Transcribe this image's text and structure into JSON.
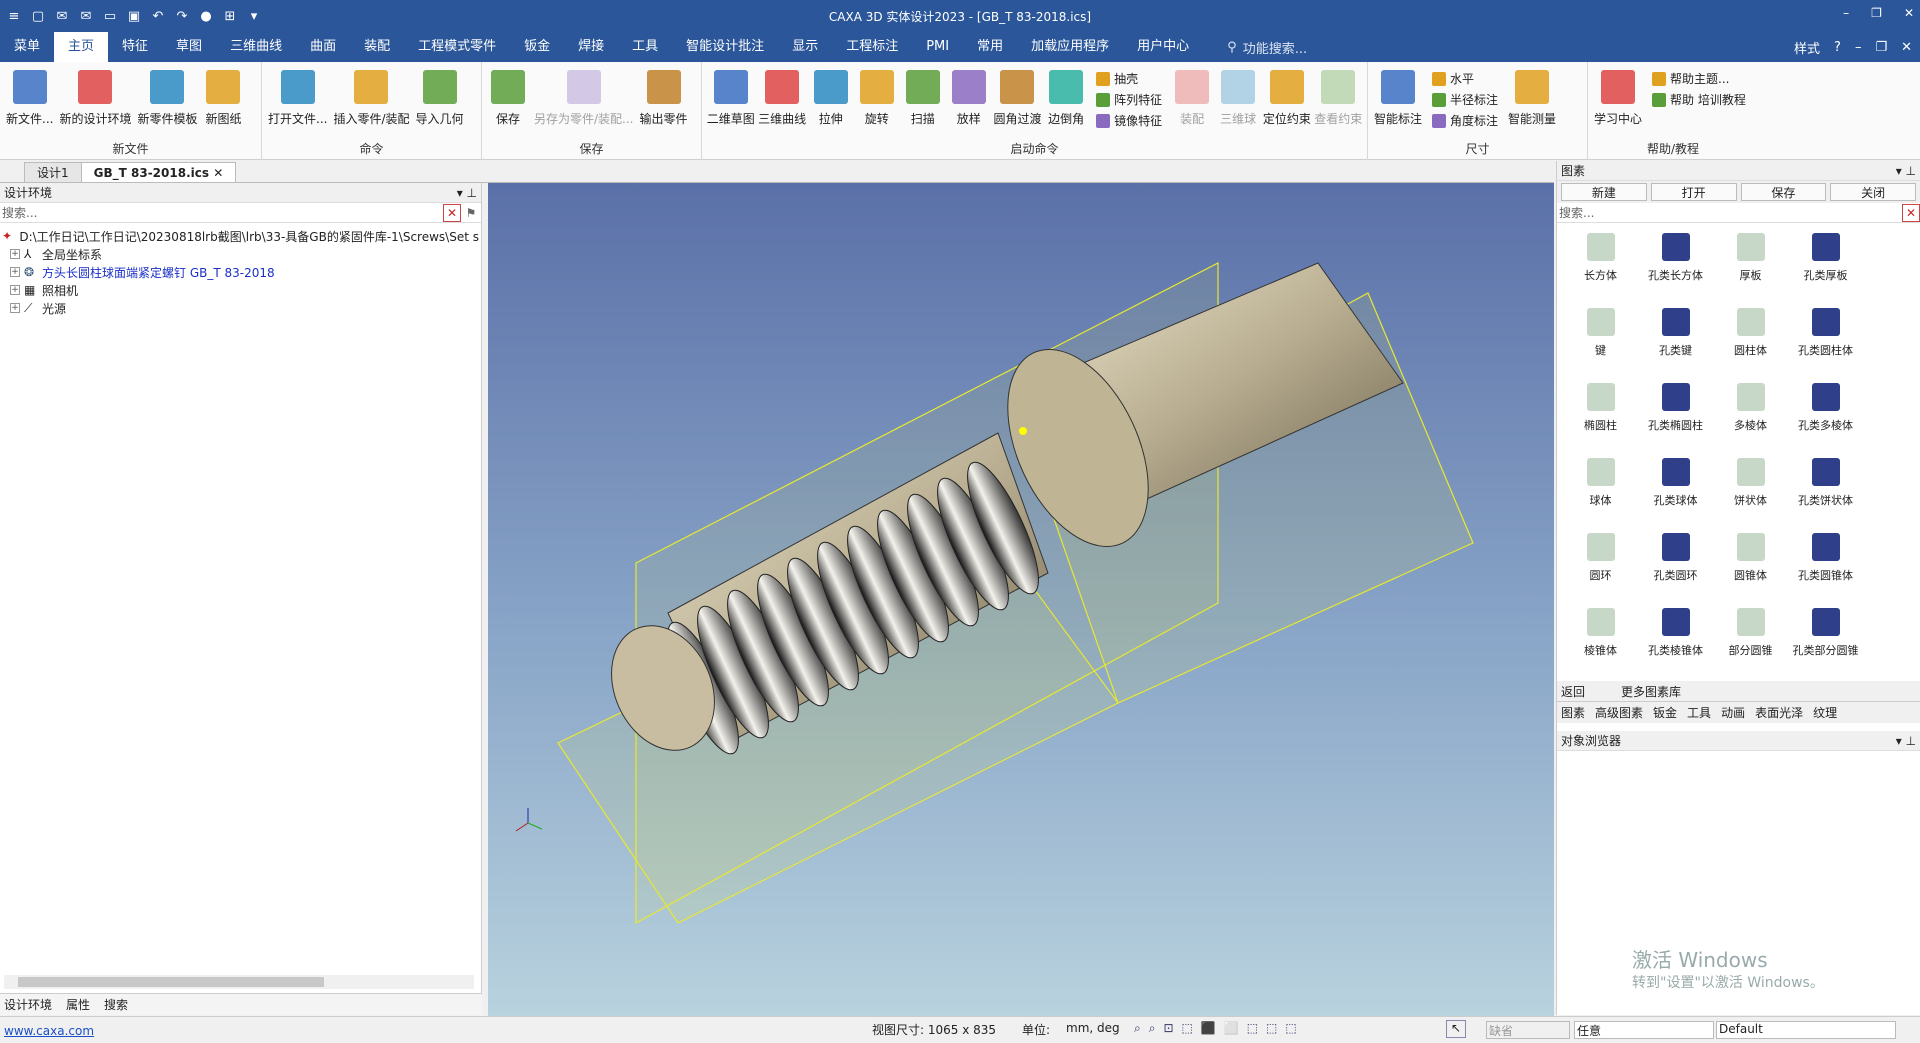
{
  "window": {
    "title": "CAXA 3D 实体设计2023 - [GB_T 83-2018.ics]"
  },
  "ribbon_tabs": [
    "菜单",
    "主页",
    "特征",
    "草图",
    "三维曲线",
    "曲面",
    "装配",
    "工程模式零件",
    "钣金",
    "焊接",
    "工具",
    "智能设计批注",
    "显示",
    "工程标注",
    "PMI",
    "常用",
    "加载应用程序",
    "用户中心"
  ],
  "function_search": "功能搜索...",
  "style_label": "样式",
  "groups": {
    "newfile": {
      "label": "新文件",
      "items": [
        "新文件...",
        "新的设计环境",
        "新零件模板",
        "新图纸"
      ]
    },
    "command": {
      "label": "命令",
      "items": [
        "打开文件...",
        "插入零件/装配",
        "导入几何"
      ]
    },
    "save": {
      "label": "保存",
      "items": [
        "保存",
        "另存为零件/装配...",
        "输出零件"
      ]
    },
    "launch": {
      "label": "启动命令",
      "items": [
        "二维草图",
        "三维曲线",
        "拉伸",
        "旋转",
        "扫描",
        "放样",
        "圆角过渡",
        "边倒角"
      ],
      "small": [
        "抽壳",
        "阵列特征",
        "镜像特征"
      ],
      "items2": [
        "装配",
        "三维球",
        "定位约束",
        "查看约束"
      ]
    },
    "dim": {
      "label": "尺寸",
      "items": [
        "智能标注"
      ],
      "small": [
        "水平",
        "半径标注",
        "角度标注"
      ],
      "items2": [
        "智能测量"
      ]
    },
    "help": {
      "label": "帮助/教程",
      "items": [
        "学习中心"
      ],
      "small": [
        "帮助主题...",
        "帮助 培训教程"
      ]
    }
  },
  "doc_tabs": [
    "设计1",
    "GB_T 83-2018.ics"
  ],
  "left_panel": {
    "title": "设计环境",
    "search": "搜索...",
    "tree": [
      "D:\\工作日记\\工作日记\\20230818lrb截图\\lrb\\33-具备GB的紧固件库-1\\Screws\\Set s",
      "全局坐标系",
      "方头长圆柱球面端紧定螺钉 GB_T 83-2018",
      "照相机",
      "光源"
    ],
    "tabs": [
      "设计环境",
      "属性",
      "搜索"
    ]
  },
  "right_panel": {
    "title": "图素",
    "buttons": [
      "新建",
      "打开",
      "保存",
      "关闭"
    ],
    "search": "搜索...",
    "items": [
      "长方体",
      "孔类长方体",
      "厚板",
      "孔类厚板",
      "键",
      "孔类键",
      "圆柱体",
      "孔类圆柱体",
      "椭圆柱",
      "孔类椭圆柱",
      "多棱体",
      "孔类多棱体",
      "球体",
      "孔类球体",
      "饼状体",
      "孔类饼状体",
      "圆环",
      "孔类圆环",
      "圆锥体",
      "孔类圆锥体",
      "棱锥体",
      "孔类棱锥体",
      "部分圆锥",
      "孔类部分圆锥"
    ],
    "back": "返回",
    "more": "更多图素库",
    "tabs": [
      "图素",
      "高级图素",
      "钣金",
      "工具",
      "动画",
      "表面光泽",
      "纹理"
    ],
    "browser": "对象浏览器"
  },
  "watermark": {
    "line1": "激活 Windows",
    "line2": "转到\"设置\"以激活 Windows。"
  },
  "status": {
    "link": "www.caxa.com",
    "viewsize": "视图尺寸: 1065 x  835",
    "unit_label": "单位:",
    "unit": "mm, deg",
    "default1": "缺省",
    "select": "任意",
    "style": "Default"
  }
}
